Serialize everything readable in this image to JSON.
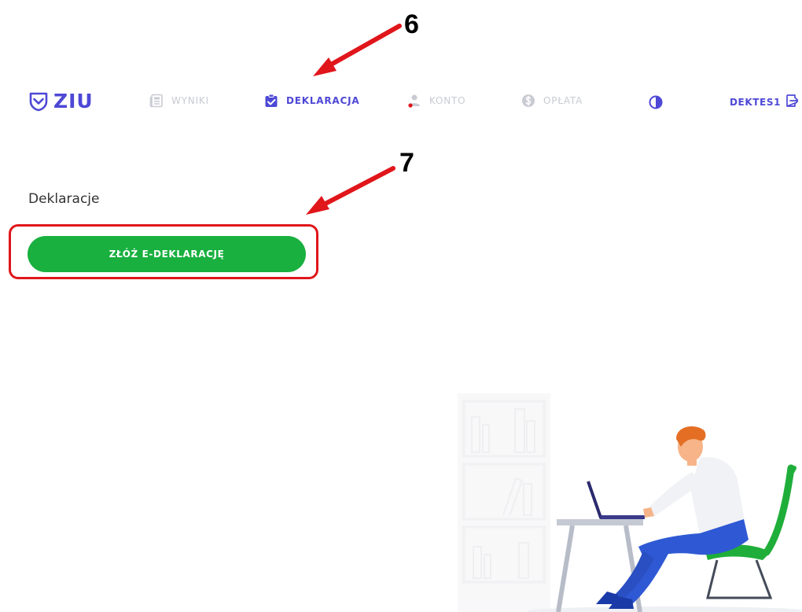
{
  "nav": {
    "logo_text": "ZIU",
    "items": [
      {
        "label": "WYNIKI",
        "active": false
      },
      {
        "label": "DEKLARACJA",
        "active": true
      },
      {
        "label": "KONTO",
        "active": false
      },
      {
        "label": "OPŁATA",
        "active": false
      }
    ],
    "username": "DEKTES1"
  },
  "annotations": {
    "step_6": "6",
    "step_7": "7"
  },
  "content": {
    "section_title": "Deklaracje",
    "primary_button_label": "ZŁÓŻ E-DEKLARACJĘ"
  },
  "colors": {
    "brand": "#4e48d6",
    "nav_inactive": "#c9cbd3",
    "primary_button": "#19b03f",
    "annotation_red": "#e0161b"
  },
  "icons": {
    "logo": "shield-check-icon",
    "wyniki": "newspaper-icon",
    "deklaracja": "clipboard-check-icon",
    "konto": "user-icon",
    "oplata": "dollar-coin-icon",
    "contrast": "contrast-icon",
    "logout": "logout-icon"
  }
}
